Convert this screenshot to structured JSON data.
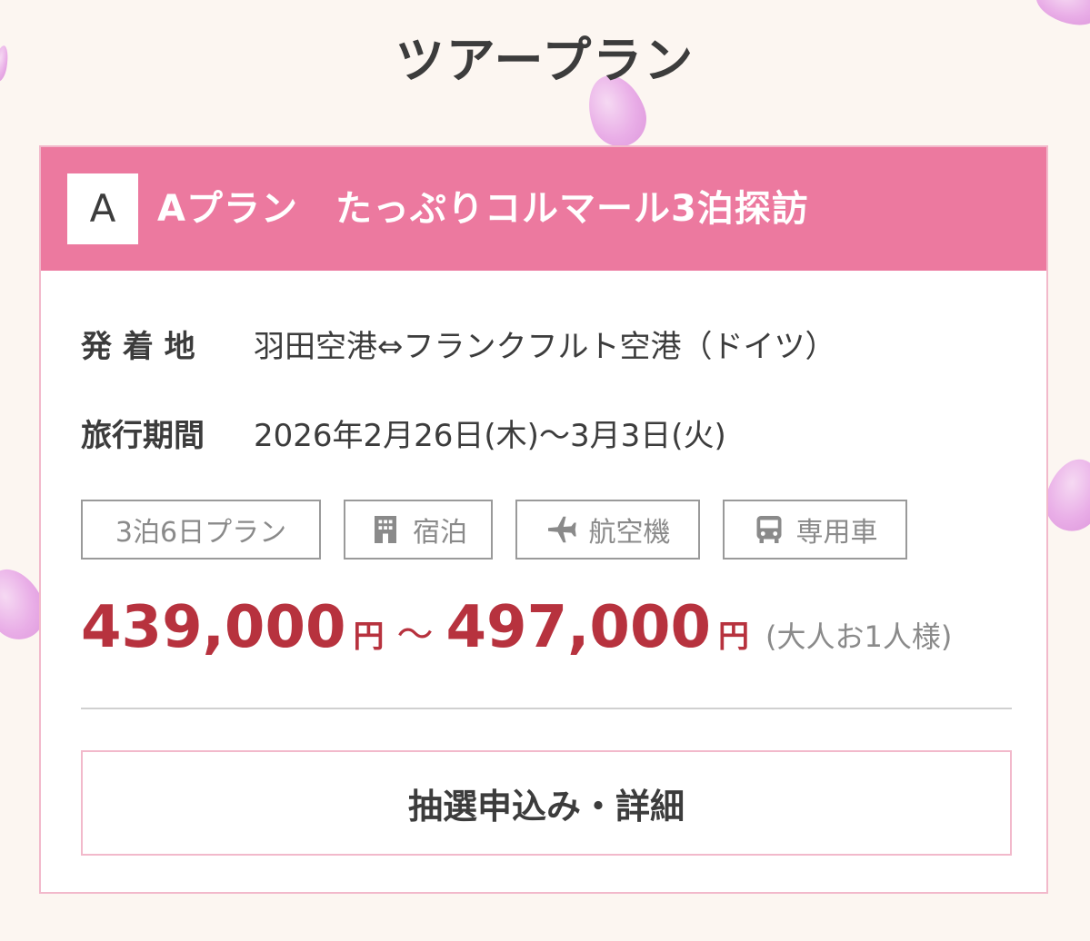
{
  "page": {
    "title": "ツアープラン"
  },
  "plan": {
    "letter": "A",
    "name": "Aプラン　たっぷりコルマール3泊探訪",
    "details": [
      {
        "label": "発 着 地",
        "value": "羽田空港⇔フランクフルト空港（ドイツ）"
      },
      {
        "label": "旅行期間",
        "value": "2026年2月26日(木)〜3月3日(火)"
      }
    ],
    "tags": [
      {
        "label": "3泊6日プラン",
        "icon": ""
      },
      {
        "label": "宿泊",
        "icon": "hotel-icon"
      },
      {
        "label": "航空機",
        "icon": "airplane-icon"
      },
      {
        "label": "専用車",
        "icon": "bus-icon"
      }
    ],
    "price": {
      "min": "439,000",
      "min_unit": "円",
      "separator": "～",
      "max": "497,000",
      "max_unit": "円",
      "note": "(大人お1人様)"
    },
    "button_label": "抽選申込み・詳細"
  },
  "colors": {
    "header_bg": "#ec799f",
    "price": "#b7323e",
    "card_border": "#f2b9cb",
    "page_bg": "#fcf6f1"
  }
}
